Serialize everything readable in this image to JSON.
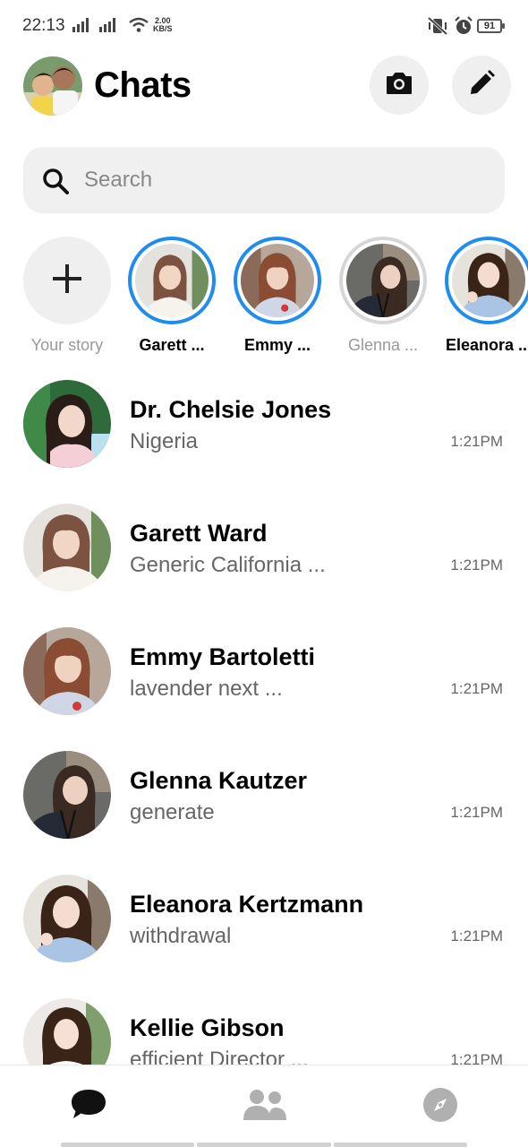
{
  "status_bar": {
    "time": "22:13",
    "net_speed_value": "2.00",
    "net_speed_unit": "KB/S",
    "battery": "91",
    "icons": [
      "signal-icon",
      "wifi-icon",
      "vibrate-mute-icon",
      "alarm-icon",
      "battery-icon"
    ]
  },
  "header": {
    "title": "Chats",
    "icons": [
      "camera-icon",
      "pencil-edit-icon"
    ]
  },
  "search": {
    "placeholder": "Search",
    "icon": "search-icon"
  },
  "stories": {
    "add_label": "Your story",
    "add_icon": "plus-icon",
    "items": [
      {
        "label": "Garett ...",
        "seen": false
      },
      {
        "label": "Emmy ...",
        "seen": false
      },
      {
        "label": "Glenna ...",
        "seen": true
      },
      {
        "label": "Eleanora ...",
        "seen": false
      }
    ]
  },
  "chats": [
    {
      "name": "Dr. Chelsie Jones",
      "preview": "Nigeria",
      "time": "1:21PM"
    },
    {
      "name": "Garett Ward",
      "preview": "Generic California ...",
      "time": "1:21PM"
    },
    {
      "name": "Emmy Bartoletti",
      "preview": "lavender next ...",
      "time": "1:21PM"
    },
    {
      "name": "Glenna Kautzer",
      "preview": "generate",
      "time": "1:21PM"
    },
    {
      "name": "Eleanora Kertzmann",
      "preview": "withdrawal",
      "time": "1:21PM"
    },
    {
      "name": "Kellie Gibson",
      "preview": "efficient Director ...",
      "time": "1:21PM"
    }
  ],
  "bottom_nav": {
    "tabs": [
      "chat-bubble-icon",
      "people-icon",
      "compass-icon"
    ],
    "active": "chat-bubble-icon"
  },
  "colors": {
    "story_ring": "#1f8cee",
    "story_ring_seen": "#d6d6d6",
    "button_bg": "#efefef",
    "search_bg": "#f0f0f0",
    "secondary_text": "#666666"
  }
}
